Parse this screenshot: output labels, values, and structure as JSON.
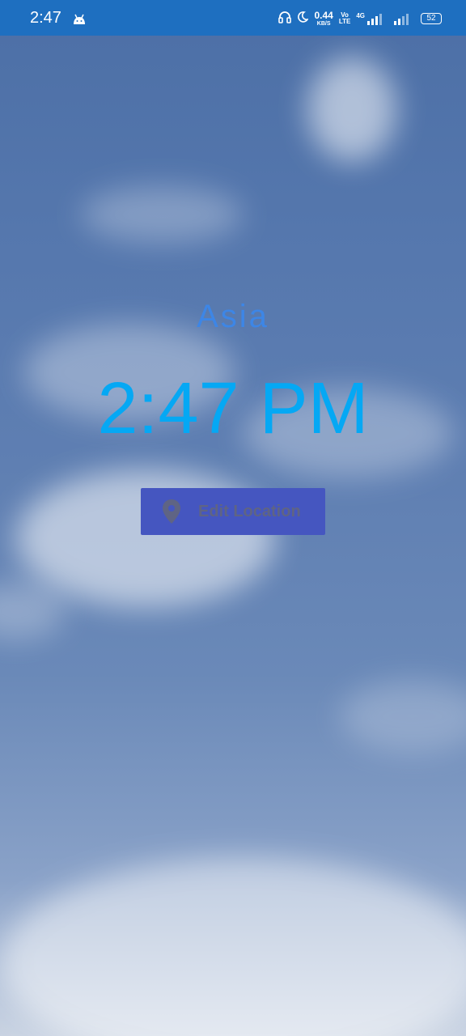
{
  "status_bar": {
    "time": "2:47",
    "network_speed_value": "0.44",
    "network_speed_unit": "KB/S",
    "volte_top": "Vo",
    "volte_bottom": "LTE",
    "network_type": "4G",
    "battery": "52",
    "icons": [
      "android-icon",
      "headphones-icon",
      "moon-icon",
      "signal-icon",
      "battery-icon"
    ]
  },
  "main": {
    "location": "Asia",
    "time": "2:47 PM",
    "edit_button_label": "Edit Location",
    "edit_button_icon": "location-pin-icon"
  },
  "colors": {
    "status_bar": "#1e6fc0",
    "location_text": "#3d86e6",
    "clock_text": "#05a8f4",
    "button_bg": "#4556c0",
    "button_text": "#5f6484"
  }
}
